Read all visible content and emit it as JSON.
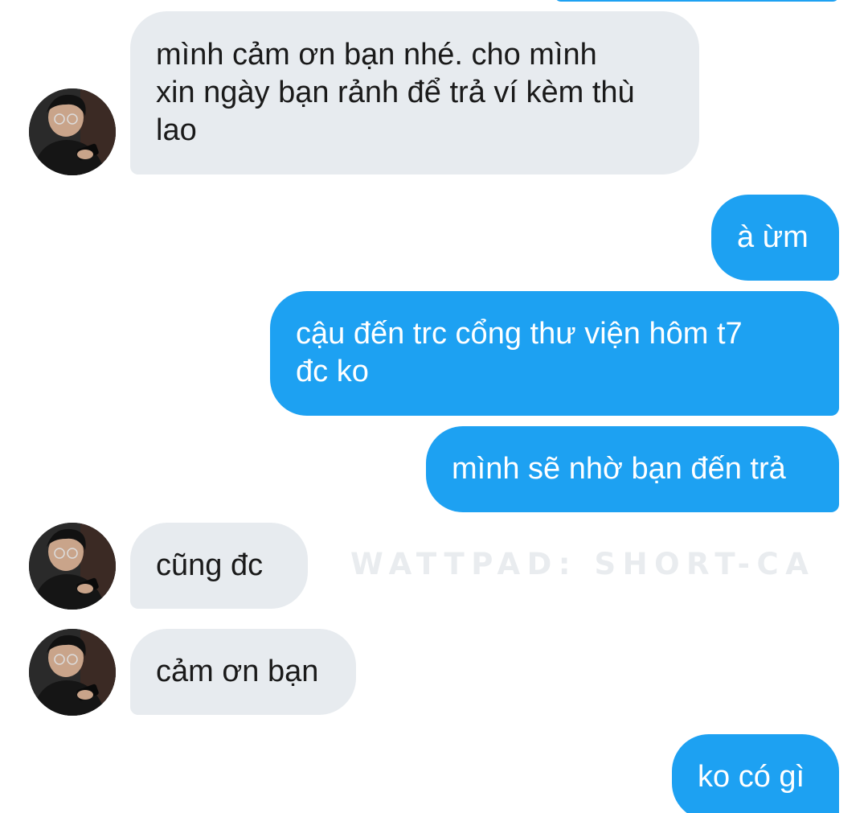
{
  "colors": {
    "incoming_bubble": "#e7ebef",
    "outgoing_bubble": "#1da1f2",
    "incoming_text": "#1a1a1a",
    "outgoing_text": "#ffffff",
    "background": "#ffffff"
  },
  "watermark": "WATTPAD: SHORT-CA",
  "messages": [
    {
      "direction": "in",
      "text": "mình cảm ơn bạn nhé. cho mình\nxin ngày bạn rảnh để trả ví kèm thù\nlao",
      "avatar": "avatar-photo-icon"
    },
    {
      "direction": "out",
      "text": "à ừm"
    },
    {
      "direction": "out",
      "text": "cậu đến trc cổng thư viện hôm t7\nđc ko"
    },
    {
      "direction": "out",
      "text": "mình sẽ nhờ bạn đến trả"
    },
    {
      "direction": "in",
      "text": "cũng đc",
      "avatar": "avatar-photo-icon"
    },
    {
      "direction": "in",
      "text": "cảm ơn bạn",
      "avatar": "avatar-photo-icon"
    },
    {
      "direction": "out",
      "text": "ko có gì"
    }
  ]
}
